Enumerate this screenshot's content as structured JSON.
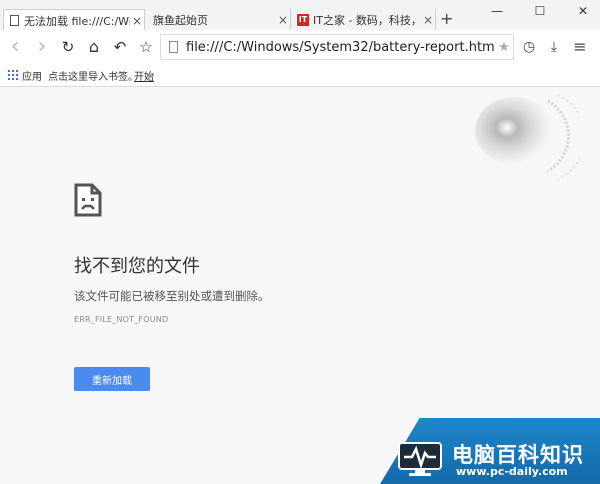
{
  "tabs": [
    {
      "label": "无法加载 file:///C:/Windo",
      "close": "×"
    },
    {
      "label": "旗鱼起始页",
      "close": "×"
    },
    {
      "label": "IT之家 - 数码，科技，生活",
      "close": "×",
      "icon_text": "IT"
    }
  ],
  "newtab_label": "+",
  "window_controls": {
    "minimize": "—",
    "maximize": "☐",
    "close": "✕"
  },
  "toolbar": {
    "back": "‹",
    "forward": "›",
    "reload": "↻",
    "home": "⌂",
    "undo": "↶",
    "bookmark_star": "☆",
    "url": "file:///C:/Windows/System32/battery-report.html",
    "addr_star": "★",
    "history": "◷",
    "download": "⤓",
    "menu": "≡"
  },
  "bookmarks": {
    "apps_label": "应用",
    "import_label": "点击这里导入书签。",
    "start_label": "开始"
  },
  "error": {
    "title": "找不到您的文件",
    "description": "该文件可能已被移至别处或遭到删除。",
    "code": "ERR_FILE_NOT_FOUND",
    "reload_label": "重新加载"
  },
  "watermark": {
    "cn_text": "电脑百科知识",
    "url_text": "www.pc-daily.com"
  },
  "colors": {
    "accent": "#4a8bf0",
    "watermark_blue": "#1674b5",
    "it_red": "#d9261c"
  }
}
